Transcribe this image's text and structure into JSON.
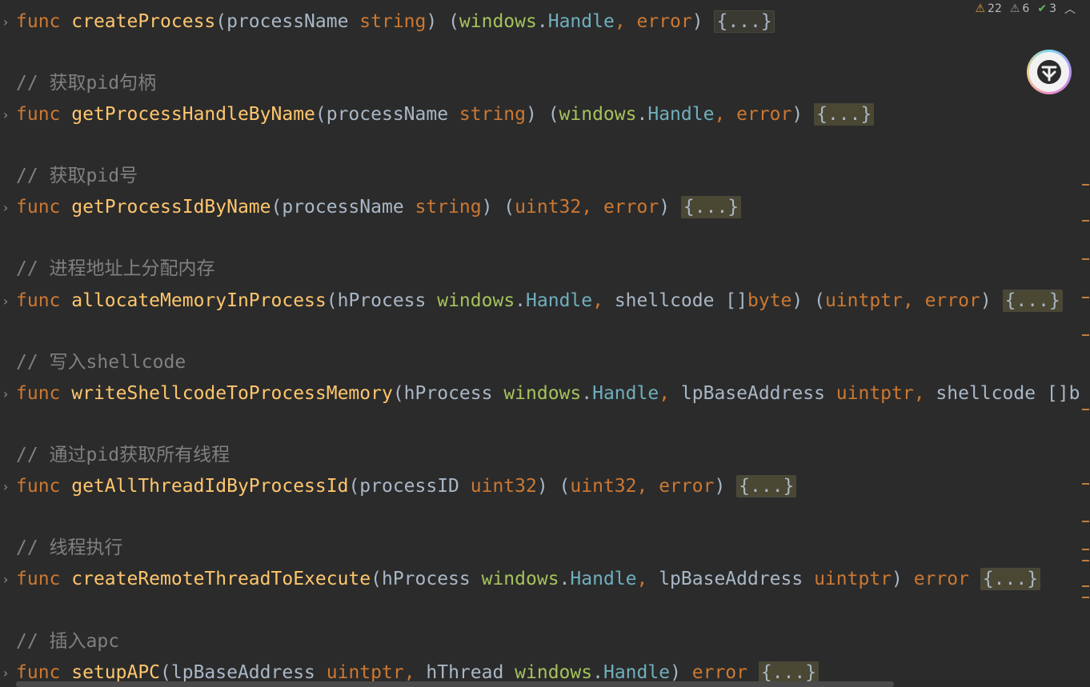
{
  "inspections": {
    "warnings": "22",
    "weak_warnings": "6",
    "typos": "3"
  },
  "lines": {
    "l1": {
      "kw": "func",
      "name": "createProcess",
      "p1": "(processName ",
      "t1": "string",
      "p2": ") (",
      "pkg": "windows",
      "dot": ".",
      "type": "Handle",
      "comma": ", ",
      "err": "error",
      "close": ") ",
      "fold": "{...}"
    },
    "c1": "// 获取pid句柄",
    "l2": {
      "kw": "func",
      "name": "getProcessHandleByName",
      "p1": "(processName ",
      "t1": "string",
      "p2": ") (",
      "pkg": "windows",
      "dot": ".",
      "type": "Handle",
      "comma": ", ",
      "err": "error",
      "close": ") ",
      "fold": "{...}"
    },
    "c2": "// 获取pid号",
    "l3": {
      "kw": "func",
      "name": "getProcessIdByName",
      "p1": "(processName ",
      "t1": "string",
      "p2": ") (",
      "t2": "uint32",
      "comma": ", ",
      "err": "error",
      "close": ") ",
      "fold": "{...}"
    },
    "c3": "// 进程地址上分配内存",
    "l4": {
      "kw": "func",
      "name": "allocateMemoryInProcess",
      "p1": "(hProcess ",
      "pkg": "windows",
      "dot": ".",
      "type": "Handle",
      "comma1": ", ",
      "p2": "shellcode []",
      "t1": "byte",
      "p3": ") (",
      "t2": "uintptr",
      "comma2": ", ",
      "err": "error",
      "close": ") ",
      "fold": "{...}"
    },
    "c4": "// 写入shellcode",
    "l5": {
      "kw": "func",
      "name": "writeShellcodeToProcessMemory",
      "p1": "(hProcess ",
      "pkg": "windows",
      "dot": ".",
      "type": "Handle",
      "comma1": ", ",
      "p2": "lpBaseAddress ",
      "t1": "uintptr",
      "comma2": ", ",
      "p3": "shellcode []b"
    },
    "c5": "// 通过pid获取所有线程",
    "l6": {
      "kw": "func",
      "name": "getAllThreadIdByProcessId",
      "p1": "(processID ",
      "t1": "uint32",
      "p2": ") (",
      "t2": "uint32",
      "comma": ", ",
      "err": "error",
      "close": ") ",
      "fold": "{...}"
    },
    "c6": "// 线程执行",
    "l7": {
      "kw": "func",
      "name": "createRemoteThreadToExecute",
      "p1": "(hProcess ",
      "pkg": "windows",
      "dot": ".",
      "type": "Handle",
      "comma1": ", ",
      "p2": "lpBaseAddress ",
      "t1": "uintptr",
      "p3": ") ",
      "err": "error",
      "sp": " ",
      "fold": "{...}"
    },
    "c7": "// 插入apc",
    "l8": {
      "kw": "func",
      "name": "setupAPC",
      "p1": "(lpBaseAddress ",
      "t1": "uintptr",
      "comma1": ", ",
      "p2": "hThread ",
      "pkg": "windows",
      "dot": ".",
      "type": "Handle",
      "p3": ") ",
      "err": "error",
      "sp": " ",
      "fold": "{...}"
    }
  }
}
